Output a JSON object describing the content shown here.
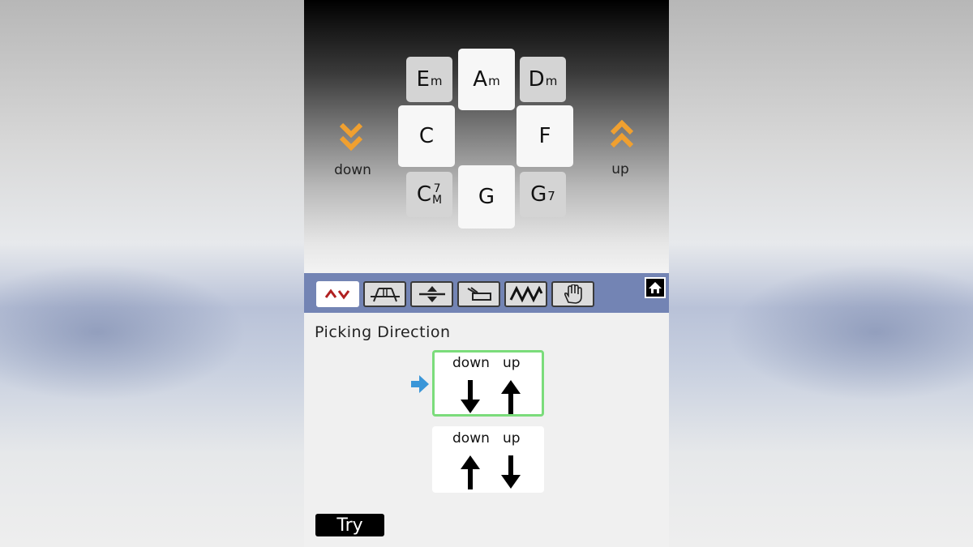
{
  "top_screen": {
    "chords": [
      {
        "id": "am",
        "root": "A",
        "suffix": "m"
      },
      {
        "id": "em",
        "root": "E",
        "suffix": "m"
      },
      {
        "id": "dm",
        "root": "D",
        "suffix": "m"
      },
      {
        "id": "c",
        "root": "C",
        "suffix": ""
      },
      {
        "id": "f",
        "root": "F",
        "suffix": ""
      },
      {
        "id": "cm7",
        "root": "C",
        "sup": "7",
        "sub": "M"
      },
      {
        "id": "g",
        "root": "G",
        "suffix": ""
      },
      {
        "id": "g7",
        "root": "G",
        "suffix": "7"
      }
    ],
    "down_label": "down",
    "up_label": "up",
    "accent_color": "#f0a030"
  },
  "toolbar": {
    "tools": [
      {
        "icon": "double-chevron-updown-icon",
        "active": true
      },
      {
        "icon": "bridge-icon",
        "active": false
      },
      {
        "icon": "up-down-split-icon",
        "active": false
      },
      {
        "icon": "strum-hand-icon",
        "active": false
      },
      {
        "icon": "wave-icon",
        "active": false
      },
      {
        "icon": "open-hand-icon",
        "active": false
      }
    ],
    "home_icon": "home-icon",
    "bar_color": "#7384b4"
  },
  "main": {
    "section_title": "Picking Direction",
    "options": [
      {
        "down_label": "down",
        "up_label": "up",
        "selected": true,
        "pattern": "down-up"
      },
      {
        "down_label": "down",
        "up_label": "up",
        "selected": false,
        "pattern": "up-down"
      }
    ],
    "pointer_color": "#3a96d8",
    "selected_border_color": "#7bdc7b",
    "try_label": "Try"
  }
}
